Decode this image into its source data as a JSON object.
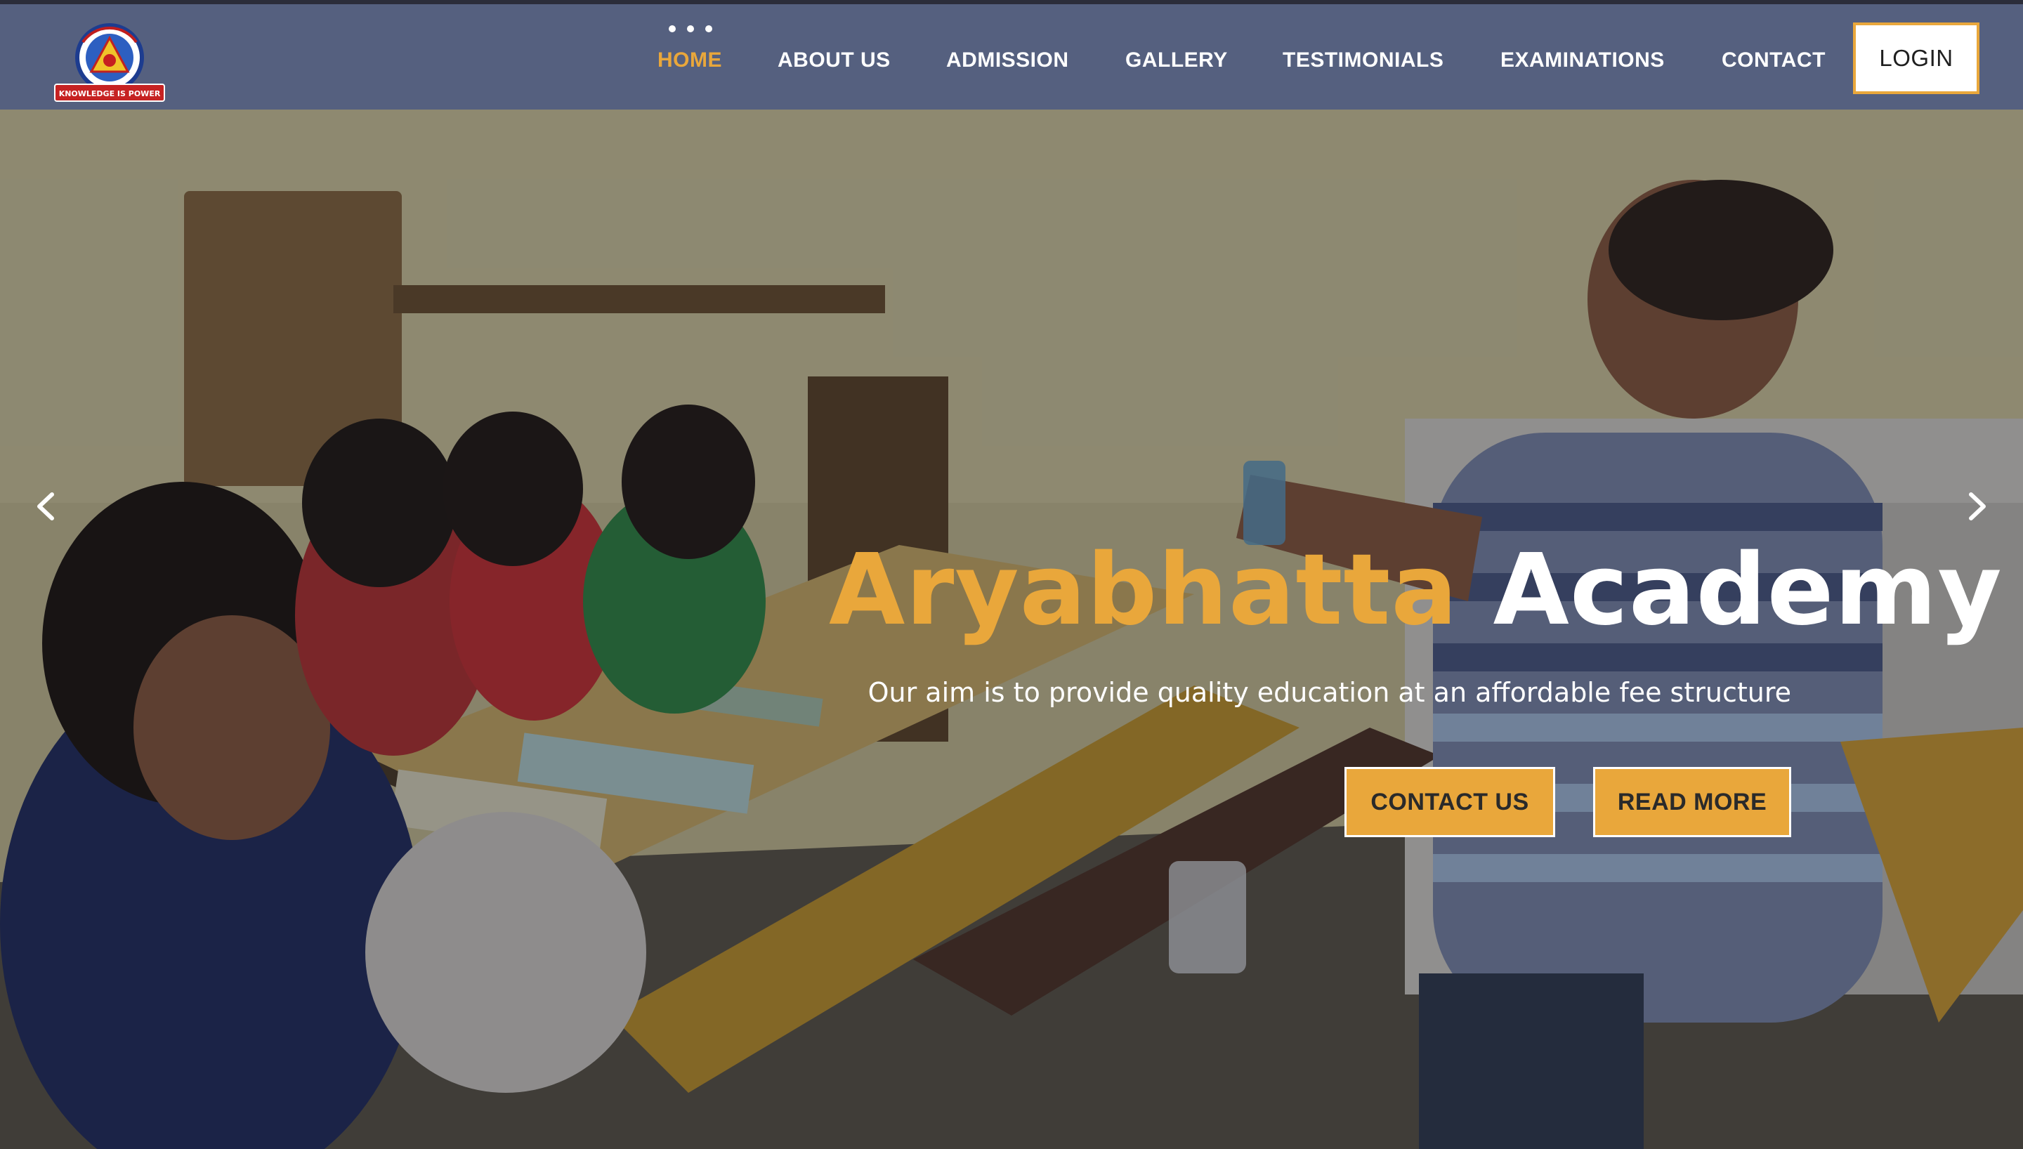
{
  "brand": {
    "logo_icon": "aryabhatta-academy-logo",
    "logo_text": "ARYABHATTA ACADEMY",
    "logo_motto": "KNOWLEDGE IS POWER"
  },
  "nav": {
    "items": [
      {
        "label": "HOME",
        "active": true
      },
      {
        "label": "ABOUT US",
        "active": false
      },
      {
        "label": "ADMISSION",
        "active": false
      },
      {
        "label": "GALLERY",
        "active": false
      },
      {
        "label": "TESTIMONIALS",
        "active": false
      },
      {
        "label": "EXAMINATIONS",
        "active": false
      },
      {
        "label": "CONTACT",
        "active": false
      }
    ],
    "login_label": "LOGIN"
  },
  "hero": {
    "title_accent": "Aryabhatta",
    "title_rest": "Academy",
    "subtitle": "Our aim is to provide quality education at an affordable fee structure",
    "contact_button": "CONTACT US",
    "read_more_button": "READ MORE",
    "prev_icon": "chevron-left-icon",
    "next_icon": "chevron-right-icon"
  },
  "colors": {
    "navbar": "#55607f",
    "accent": "#e9a73b",
    "text_light": "#ffffff"
  }
}
